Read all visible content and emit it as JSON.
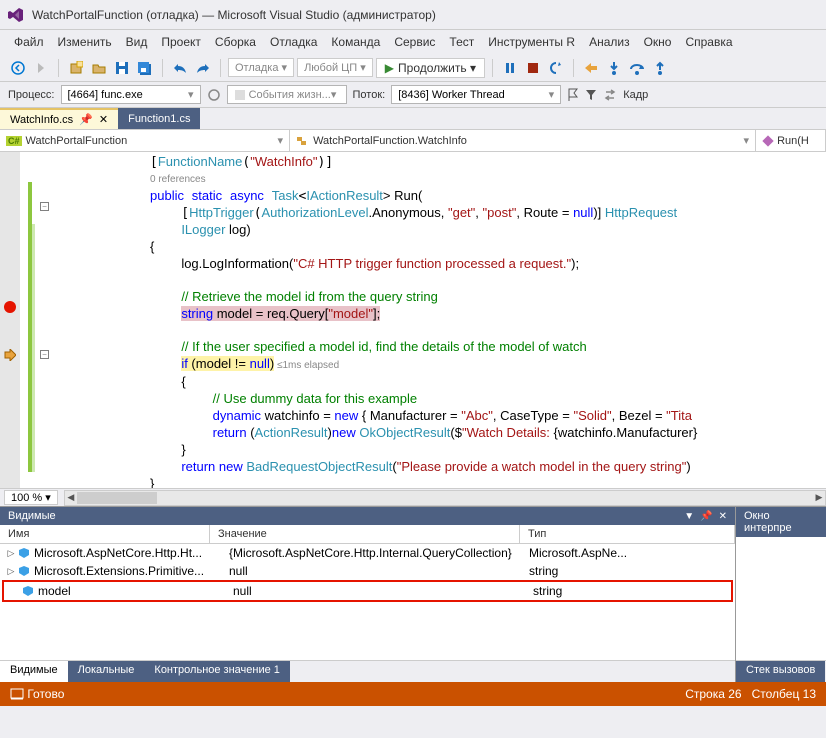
{
  "title": "WatchPortalFunction (отладка) — Microsoft Visual Studio (администратор)",
  "menu": [
    "Файл",
    "Изменить",
    "Вид",
    "Проект",
    "Сборка",
    "Отладка",
    "Команда",
    "Сервис",
    "Тест",
    "Инструменты R",
    "Анализ",
    "Окно",
    "Справка"
  ],
  "toolbar": {
    "config": "Отладка",
    "platform": "Любой ЦП",
    "continue": "Продолжить"
  },
  "toolbar2": {
    "process_label": "Процесс:",
    "process_value": "[4664] func.exe",
    "events_label": "События жизн...",
    "thread_label": "Поток:",
    "thread_value": "[8436] Worker Thread",
    "frame_label": "Кадр"
  },
  "tabs": [
    {
      "label": "WatchInfo.cs",
      "active": true,
      "pinned": true
    },
    {
      "label": "Function1.cs",
      "active": false
    }
  ],
  "nav": {
    "left": "WatchPortalFunction",
    "mid": "WatchPortalFunction.WatchInfo",
    "right": "Run(H"
  },
  "code": {
    "l1a": "[",
    "l1b": "FunctionName",
    "l1c": "(",
    "l1d": "\"WatchInfo\"",
    "l1e": ")]",
    "l2": "0 references",
    "l3a": "public",
    "l3b": "static",
    "l3c": "async",
    "l3d": "Task",
    "l3e": "IActionResult",
    "l3f": "> Run(",
    "l4a": "[",
    "l4b": "HttpTrigger",
    "l4c": "(",
    "l4d": "AuthorizationLevel",
    "l4e": ".Anonymous, ",
    "l4f": "\"get\"",
    "l4g": ", ",
    "l4h": "\"post\"",
    "l4i": ", Route = ",
    "l4j": "null",
    "l4k": ")] ",
    "l4l": "HttpRequest",
    "l5a": "ILogger",
    "l5b": " log)",
    "l6": "{",
    "l7a": "log.LogInformation(",
    "l7b": "\"C# HTTP trigger function processed a request.\"",
    "l7c": ");",
    "l8": "// Retrieve the model id from the query string",
    "l9a": "string",
    "l9b": " model = req.Query[",
    "l9c": "\"model\"",
    "l9d": "];",
    "l10": "// If the user specified a model id, find the details of the model of watch",
    "l11a": "if",
    "l11b": " (model != ",
    "l11c": "null",
    "l11d": ")",
    "l11e": " ≤1ms elapsed",
    "l12": "{",
    "l13": "// Use dummy data for this example",
    "l14a": "dynamic",
    "l14b": " watchinfo = ",
    "l14c": "new",
    "l14d": " { Manufacturer = ",
    "l14e": "\"Abc\"",
    "l14f": ", CaseType = ",
    "l14g": "\"Solid\"",
    "l14h": ", Bezel = ",
    "l14i": "\"Tita",
    "l15a": "return",
    "l15b": " (",
    "l15c": "ActionResult",
    "l15d": ")",
    "l15e": "new",
    "l15f": " ",
    "l15g": "OkObjectResult",
    "l15h": "($",
    "l15i": "\"Watch Details: ",
    "l15j": "{watchinfo.Manufacturer}",
    "l16": "}",
    "l17a": "return",
    "l17b": " ",
    "l17c": "new",
    "l17d": " ",
    "l17e": "BadRequestObjectResult",
    "l17f": "(",
    "l17g": "\"Please provide a watch model in the query string\"",
    "l17h": ")",
    "l18": "}"
  },
  "zoom": "100 %",
  "locals_panel": {
    "title": "Видимые",
    "cols": {
      "name": "Имя",
      "value": "Значение",
      "type": "Тип"
    },
    "rows": [
      {
        "name": "Microsoft.AspNetCore.Http.Ht...",
        "value": "{Microsoft.AspNetCore.Http.Internal.QueryCollection}",
        "type": "Microsoft.AspNe..."
      },
      {
        "name": "Microsoft.Extensions.Primitive...",
        "value": "null",
        "type": "string"
      },
      {
        "name": "model",
        "value": "null",
        "type": "string"
      }
    ]
  },
  "panel_tabs": [
    "Видимые",
    "Локальные",
    "Контрольное значение 1"
  ],
  "right_panel": {
    "title": "Окно интерпре",
    "tab": "Стек вызовов"
  },
  "status": {
    "ready": "Готово",
    "line": "Строка 26",
    "col": "Столбец 13"
  }
}
